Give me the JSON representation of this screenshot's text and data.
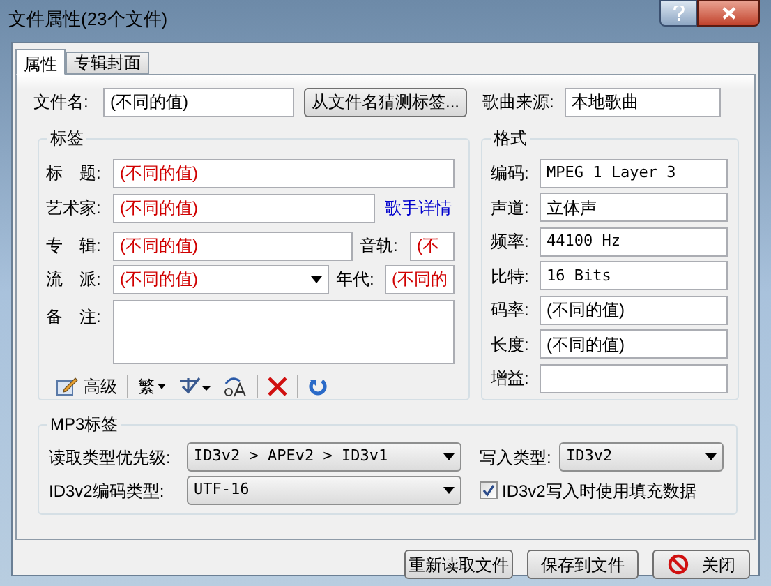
{
  "window": {
    "title": "文件属性(23个文件)"
  },
  "tabs": [
    {
      "label": "属性",
      "selected": true
    },
    {
      "label": "专辑封面",
      "selected": false
    }
  ],
  "file_name": {
    "label": "文件名:",
    "value": "(不同的值)"
  },
  "guess_button": "从文件名猜测标签...",
  "source": {
    "label": "歌曲来源:",
    "value": "本地歌曲"
  },
  "tag_group": {
    "title": "标签",
    "title_field": {
      "label": "标　题:",
      "value": "(不同的值)"
    },
    "artist": {
      "label": "艺术家:",
      "value": "(不同的值)",
      "link": "歌手详情"
    },
    "album": {
      "label": "专　辑:",
      "value": "(不同的值)"
    },
    "track": {
      "label": "音轨:",
      "value": "(不"
    },
    "genre": {
      "label": "流　派:",
      "value": "(不同的值)"
    },
    "year": {
      "label": "年代:",
      "value": "(不同的"
    },
    "comment": {
      "label": "备　注:"
    },
    "toolbar": [
      {
        "kind": "advanced",
        "label": "高级"
      },
      {
        "kind": "traditional",
        "label": "繁"
      },
      {
        "kind": "convert"
      },
      {
        "kind": "case"
      },
      {
        "kind": "delete"
      },
      {
        "kind": "undo"
      }
    ]
  },
  "format_group": {
    "title": "格式",
    "rows": [
      {
        "label": "编码:",
        "value": "MPEG 1 Layer 3",
        "mono": true
      },
      {
        "label": "声道:",
        "value": "立体声",
        "mono": false
      },
      {
        "label": "频率:",
        "value": "44100 Hz",
        "mono": true
      },
      {
        "label": "比特:",
        "value": "16 Bits",
        "mono": true
      },
      {
        "label": "码率:",
        "value": "(不同的值)",
        "mono": false
      },
      {
        "label": "长度:",
        "value": "(不同的值)",
        "mono": false
      },
      {
        "label": "增益:"
      }
    ]
  },
  "mp3_group": {
    "title": "MP3标签",
    "read_priority": {
      "label": "读取类型优先级:",
      "value": "ID3v2 > APEv2 > ID3v1"
    },
    "write_type": {
      "label": "写入类型:",
      "value": "ID3v2"
    },
    "encoding": {
      "label": "ID3v2编码类型:",
      "value": "UTF-16"
    },
    "padding": {
      "label": "ID3v2写入时使用填充数据",
      "checked": true
    }
  },
  "buttons": [
    {
      "kind": "reload",
      "label": "重新读取文件"
    },
    {
      "kind": "save",
      "label": "保存到文件"
    },
    {
      "kind": "close",
      "label": "关闭"
    }
  ]
}
